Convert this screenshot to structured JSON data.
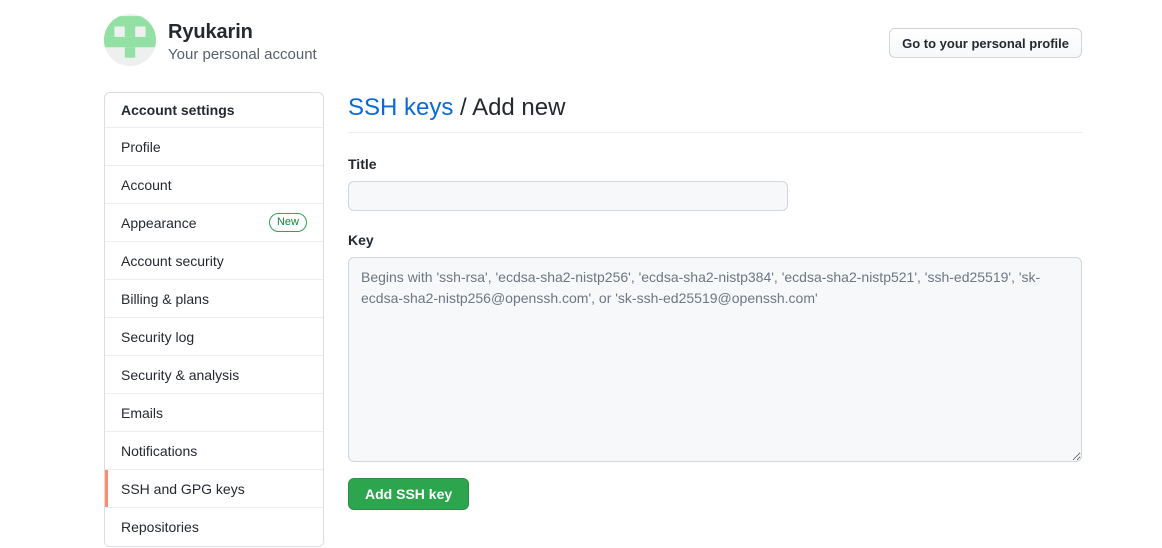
{
  "header": {
    "user_name": "Ryukarin",
    "user_subtitle": "Your personal account",
    "profile_button": "Go to your personal profile",
    "avatar_bg": "#eef0ef",
    "avatar_fg": "#92e0a3"
  },
  "sidebar": {
    "title": "Account settings",
    "accent_color": "#fd8c73",
    "items": [
      {
        "label": "Profile",
        "badge": null,
        "selected": false
      },
      {
        "label": "Account",
        "badge": null,
        "selected": false
      },
      {
        "label": "Appearance",
        "badge": "New",
        "selected": false
      },
      {
        "label": "Account security",
        "badge": null,
        "selected": false
      },
      {
        "label": "Billing & plans",
        "badge": null,
        "selected": false
      },
      {
        "label": "Security log",
        "badge": null,
        "selected": false
      },
      {
        "label": "Security & analysis",
        "badge": null,
        "selected": false
      },
      {
        "label": "Emails",
        "badge": null,
        "selected": false
      },
      {
        "label": "Notifications",
        "badge": null,
        "selected": false
      },
      {
        "label": "SSH and GPG keys",
        "badge": null,
        "selected": true
      },
      {
        "label": "Repositories",
        "badge": null,
        "selected": false
      }
    ]
  },
  "main": {
    "breadcrumb_link": "SSH keys",
    "breadcrumb_separator": " / ",
    "breadcrumb_current": "Add new",
    "title_label": "Title",
    "title_value": "",
    "title_placeholder": "",
    "key_label": "Key",
    "key_value": "",
    "key_placeholder": "Begins with 'ssh-rsa', 'ecdsa-sha2-nistp256', 'ecdsa-sha2-nistp384', 'ecdsa-sha2-nistp521', 'ssh-ed25519', 'sk-ecdsa-sha2-nistp256@openssh.com', or 'sk-ssh-ed25519@openssh.com'",
    "submit_label": "Add SSH key",
    "submit_color": "#2da44e",
    "link_color": "#0969da"
  }
}
